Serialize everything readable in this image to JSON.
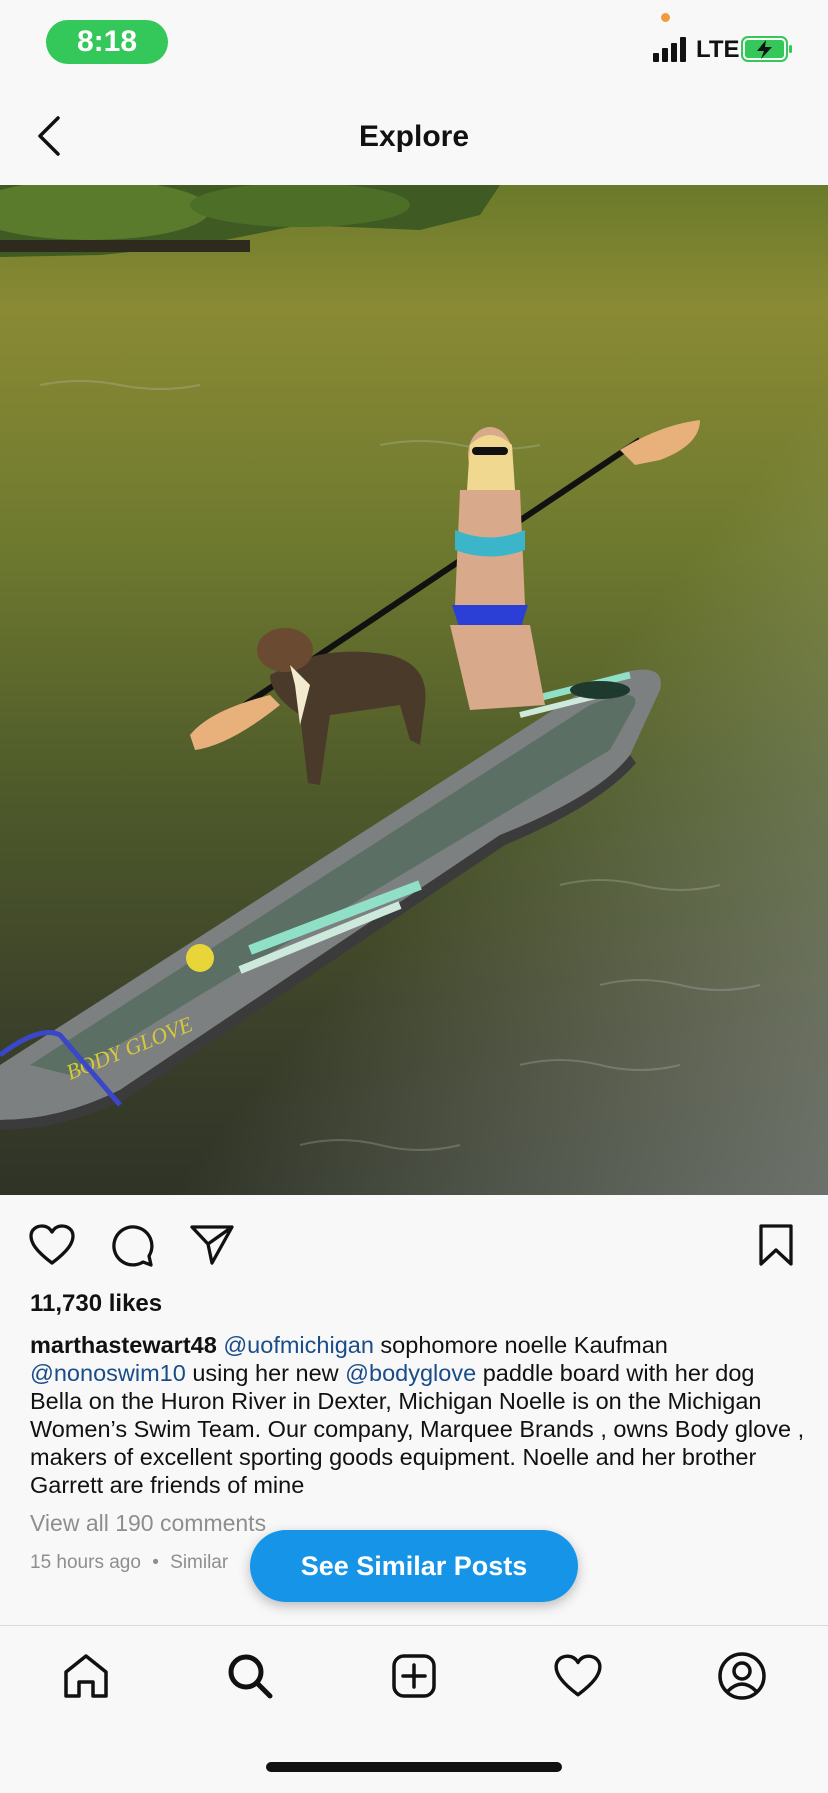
{
  "status_bar": {
    "time": "8:18",
    "network": "LTE"
  },
  "nav": {
    "title": "Explore"
  },
  "post": {
    "likes": "11,730 likes",
    "username": "marthastewart48",
    "caption_parts": [
      {
        "text": "@uofmichigan",
        "mention": true
      },
      {
        "text": " sophomore noelle Kaufman ",
        "mention": false
      },
      {
        "text": "@nonoswim10",
        "mention": true
      },
      {
        "text": " using her new ",
        "mention": false
      },
      {
        "text": "@bodyglove",
        "mention": true
      },
      {
        "text": " paddle board with her dog Bella on the Huron River in Dexter, Michigan  Noelle is on the Michigan Women’s Swim Team.  Our company, Marquee Brands , owns Body glove , makers of excellent sporting goods equipment. Noelle and her brother Garrett are friends of mine",
        "mention": false
      }
    ],
    "view_comments": "View all 190 comments",
    "time_ago": "15 hours ago",
    "meta_separator": "•",
    "meta_similar": "Similar",
    "board_brand": "BODY GLOVE"
  },
  "see_similar_label": "See Similar Posts",
  "colors": {
    "accent": "#1694e8",
    "status_green": "#34c759",
    "mention": "#1a4c8a"
  },
  "icons": {
    "nav": "chevron-left-icon",
    "actions": [
      "heart-icon",
      "comment-icon",
      "send-icon",
      "bookmark-icon"
    ],
    "tabs": [
      "home-icon",
      "search-icon",
      "add-post-icon",
      "activity-heart-icon",
      "profile-icon"
    ]
  }
}
